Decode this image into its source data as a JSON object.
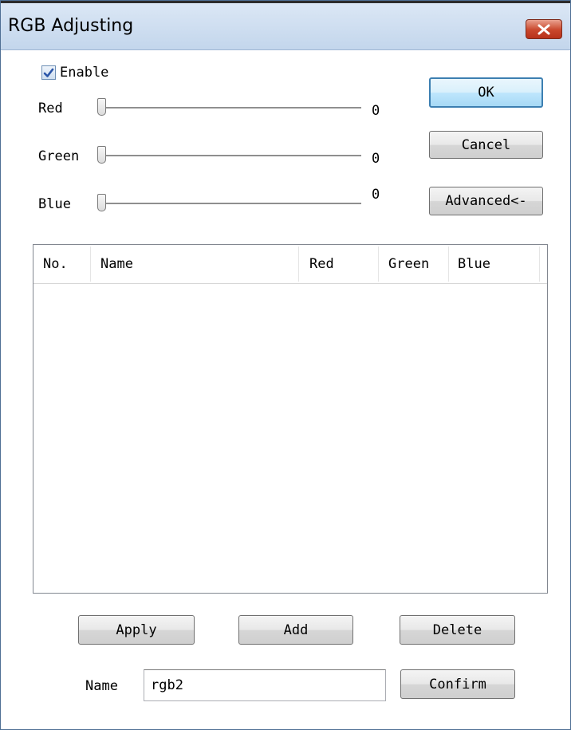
{
  "window": {
    "title": "RGB Adjusting"
  },
  "enable": {
    "label": "Enable",
    "checked": true
  },
  "sliders": [
    {
      "label": "Red",
      "value": "0"
    },
    {
      "label": "Green",
      "value": "0"
    },
    {
      "label": "Blue",
      "value": "0"
    }
  ],
  "buttons": {
    "ok": "OK",
    "cancel": "Cancel",
    "advanced": "Advanced<-",
    "apply": "Apply",
    "add": "Add",
    "delete": "Delete",
    "confirm": "Confirm"
  },
  "table": {
    "columns": [
      "No.",
      "Name",
      "Red",
      "Green",
      "Blue"
    ],
    "rows": []
  },
  "name_field": {
    "label": "Name",
    "value": "rgb2"
  },
  "colors": {
    "title_bar": "#c9daee",
    "close_button": "#c9472c",
    "default_button_border": "#3c7fb1"
  }
}
